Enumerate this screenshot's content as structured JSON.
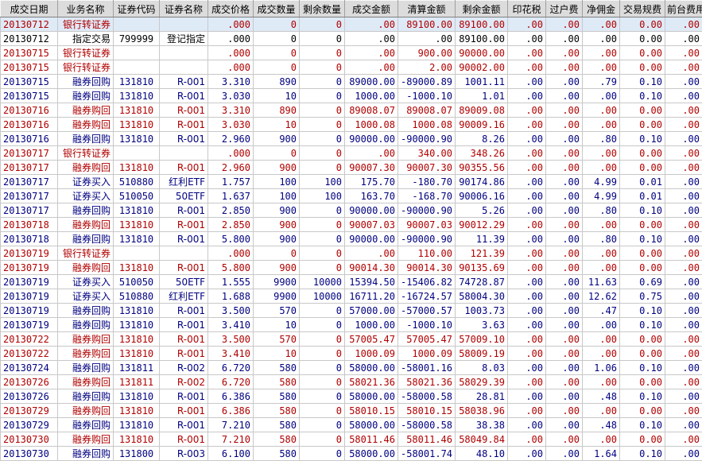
{
  "headers": [
    "成交日期",
    "业务名称",
    "证券代码",
    "证券名称",
    "成交价格",
    "成交数量",
    "剩余数量",
    "成交金额",
    "清算金额",
    "剩余金额",
    "印花税",
    "过户费",
    "净佣金",
    "交易规费",
    "前台费用"
  ],
  "rows": [
    {
      "color": "red",
      "cells": [
        "20130712",
        "银行转证券",
        "",
        "",
        ".000",
        "0",
        "0",
        ".00",
        "89100.00",
        "89100.00",
        ".00",
        ".00",
        ".00",
        "0.00",
        ".00"
      ]
    },
    {
      "color": "black",
      "cells": [
        "20130712",
        "指定交易",
        "799999",
        "登记指定",
        ".000",
        "0",
        "0",
        ".00",
        ".00",
        "89100.00",
        ".00",
        ".00",
        ".00",
        "0.00",
        ".00"
      ]
    },
    {
      "color": "red",
      "cells": [
        "20130715",
        "银行转证券",
        "",
        "",
        ".000",
        "0",
        "0",
        ".00",
        "900.00",
        "90000.00",
        ".00",
        ".00",
        ".00",
        "0.00",
        ".00"
      ]
    },
    {
      "color": "red",
      "cells": [
        "20130715",
        "银行转证券",
        "",
        "",
        ".000",
        "0",
        "0",
        ".00",
        "2.00",
        "90002.00",
        ".00",
        ".00",
        ".00",
        "0.00",
        ".00"
      ]
    },
    {
      "color": "blue",
      "cells": [
        "20130715",
        "融券回购",
        "131810",
        "R-001",
        "3.310",
        "890",
        "0",
        "89000.00",
        "-89000.89",
        "1001.11",
        ".00",
        ".00",
        ".79",
        "0.10",
        ".00"
      ]
    },
    {
      "color": "blue",
      "cells": [
        "20130715",
        "融券回购",
        "131810",
        "R-001",
        "3.030",
        "10",
        "0",
        "1000.00",
        "-1000.10",
        "1.01",
        ".00",
        ".00",
        ".00",
        "0.10",
        ".00"
      ]
    },
    {
      "color": "red",
      "cells": [
        "20130716",
        "融券购回",
        "131810",
        "R-001",
        "3.310",
        "890",
        "0",
        "89008.07",
        "89008.07",
        "89009.08",
        ".00",
        ".00",
        ".00",
        "0.00",
        ".00"
      ]
    },
    {
      "color": "red",
      "cells": [
        "20130716",
        "融券购回",
        "131810",
        "R-001",
        "3.030",
        "10",
        "0",
        "1000.08",
        "1000.08",
        "90009.16",
        ".00",
        ".00",
        ".00",
        "0.00",
        ".00"
      ]
    },
    {
      "color": "blue",
      "cells": [
        "20130716",
        "融券回购",
        "131810",
        "R-001",
        "2.960",
        "900",
        "0",
        "90000.00",
        "-90000.90",
        "8.26",
        ".00",
        ".00",
        ".80",
        "0.10",
        ".00"
      ]
    },
    {
      "color": "red",
      "cells": [
        "20130717",
        "银行转证券",
        "",
        "",
        ".000",
        "0",
        "0",
        ".00",
        "340.00",
        "348.26",
        ".00",
        ".00",
        ".00",
        "0.00",
        ".00"
      ]
    },
    {
      "color": "red",
      "cells": [
        "20130717",
        "融券购回",
        "131810",
        "R-001",
        "2.960",
        "900",
        "0",
        "90007.30",
        "90007.30",
        "90355.56",
        ".00",
        ".00",
        ".00",
        "0.00",
        ".00"
      ]
    },
    {
      "color": "blue",
      "cells": [
        "20130717",
        "证券买入",
        "510880",
        "红利ETF",
        "1.757",
        "100",
        "100",
        "175.70",
        "-180.70",
        "90174.86",
        ".00",
        ".00",
        "4.99",
        "0.01",
        ".00"
      ]
    },
    {
      "color": "blue",
      "cells": [
        "20130717",
        "证券买入",
        "510050",
        "50ETF",
        "1.637",
        "100",
        "100",
        "163.70",
        "-168.70",
        "90006.16",
        ".00",
        ".00",
        "4.99",
        "0.01",
        ".00"
      ]
    },
    {
      "color": "blue",
      "cells": [
        "20130717",
        "融券回购",
        "131810",
        "R-001",
        "2.850",
        "900",
        "0",
        "90000.00",
        "-90000.90",
        "5.26",
        ".00",
        ".00",
        ".80",
        "0.10",
        ".00"
      ]
    },
    {
      "color": "red",
      "cells": [
        "20130718",
        "融券购回",
        "131810",
        "R-001",
        "2.850",
        "900",
        "0",
        "90007.03",
        "90007.03",
        "90012.29",
        ".00",
        ".00",
        ".00",
        "0.00",
        ".00"
      ]
    },
    {
      "color": "blue",
      "cells": [
        "20130718",
        "融券回购",
        "131810",
        "R-001",
        "5.800",
        "900",
        "0",
        "90000.00",
        "-90000.90",
        "11.39",
        ".00",
        ".00",
        ".80",
        "0.10",
        ".00"
      ]
    },
    {
      "color": "red",
      "cells": [
        "20130719",
        "银行转证券",
        "",
        "",
        ".000",
        "0",
        "0",
        ".00",
        "110.00",
        "121.39",
        ".00",
        ".00",
        ".00",
        "0.00",
        ".00"
      ]
    },
    {
      "color": "red",
      "cells": [
        "20130719",
        "融券购回",
        "131810",
        "R-001",
        "5.800",
        "900",
        "0",
        "90014.30",
        "90014.30",
        "90135.69",
        ".00",
        ".00",
        ".00",
        "0.00",
        ".00"
      ]
    },
    {
      "color": "blue",
      "cells": [
        "20130719",
        "证券买入",
        "510050",
        "50ETF",
        "1.555",
        "9900",
        "10000",
        "15394.50",
        "-15406.82",
        "74728.87",
        ".00",
        ".00",
        "11.63",
        "0.69",
        ".00"
      ]
    },
    {
      "color": "blue",
      "cells": [
        "20130719",
        "证券买入",
        "510880",
        "红利ETF",
        "1.688",
        "9900",
        "10000",
        "16711.20",
        "-16724.57",
        "58004.30",
        ".00",
        ".00",
        "12.62",
        "0.75",
        ".00"
      ]
    },
    {
      "color": "blue",
      "cells": [
        "20130719",
        "融券回购",
        "131810",
        "R-001",
        "3.500",
        "570",
        "0",
        "57000.00",
        "-57000.57",
        "1003.73",
        ".00",
        ".00",
        ".47",
        "0.10",
        ".00"
      ]
    },
    {
      "color": "blue",
      "cells": [
        "20130719",
        "融券回购",
        "131810",
        "R-001",
        "3.410",
        "10",
        "0",
        "1000.00",
        "-1000.10",
        "3.63",
        ".00",
        ".00",
        ".00",
        "0.10",
        ".00"
      ]
    },
    {
      "color": "red",
      "cells": [
        "20130722",
        "融券购回",
        "131810",
        "R-001",
        "3.500",
        "570",
        "0",
        "57005.47",
        "57005.47",
        "57009.10",
        ".00",
        ".00",
        ".00",
        "0.00",
        ".00"
      ]
    },
    {
      "color": "red",
      "cells": [
        "20130722",
        "融券购回",
        "131810",
        "R-001",
        "3.410",
        "10",
        "0",
        "1000.09",
        "1000.09",
        "58009.19",
        ".00",
        ".00",
        ".00",
        "0.00",
        ".00"
      ]
    },
    {
      "color": "blue",
      "cells": [
        "20130724",
        "融券回购",
        "131811",
        "R-002",
        "6.720",
        "580",
        "0",
        "58000.00",
        "-58001.16",
        "8.03",
        ".00",
        ".00",
        "1.06",
        "0.10",
        ".00"
      ]
    },
    {
      "color": "red",
      "cells": [
        "20130726",
        "融券购回",
        "131811",
        "R-002",
        "6.720",
        "580",
        "0",
        "58021.36",
        "58021.36",
        "58029.39",
        ".00",
        ".00",
        ".00",
        "0.00",
        ".00"
      ]
    },
    {
      "color": "blue",
      "cells": [
        "20130726",
        "融券回购",
        "131810",
        "R-001",
        "6.386",
        "580",
        "0",
        "58000.00",
        "-58000.58",
        "28.81",
        ".00",
        ".00",
        ".48",
        "0.10",
        ".00"
      ]
    },
    {
      "color": "red",
      "cells": [
        "20130729",
        "融券购回",
        "131810",
        "R-001",
        "6.386",
        "580",
        "0",
        "58010.15",
        "58010.15",
        "58038.96",
        ".00",
        ".00",
        ".00",
        "0.00",
        ".00"
      ]
    },
    {
      "color": "blue",
      "cells": [
        "20130729",
        "融券回购",
        "131810",
        "R-001",
        "7.210",
        "580",
        "0",
        "58000.00",
        "-58000.58",
        "38.38",
        ".00",
        ".00",
        ".48",
        "0.10",
        ".00"
      ]
    },
    {
      "color": "red",
      "cells": [
        "20130730",
        "融券购回",
        "131810",
        "R-001",
        "7.210",
        "580",
        "0",
        "58011.46",
        "58011.46",
        "58049.84",
        ".00",
        ".00",
        ".00",
        "0.00",
        ".00"
      ]
    },
    {
      "color": "blue",
      "cells": [
        "20130730",
        "融券回购",
        "131800",
        "R-003",
        "6.100",
        "580",
        "0",
        "58000.00",
        "-58001.74",
        "48.10",
        ".00",
        ".00",
        "1.64",
        "0.10",
        ".00"
      ]
    }
  ]
}
